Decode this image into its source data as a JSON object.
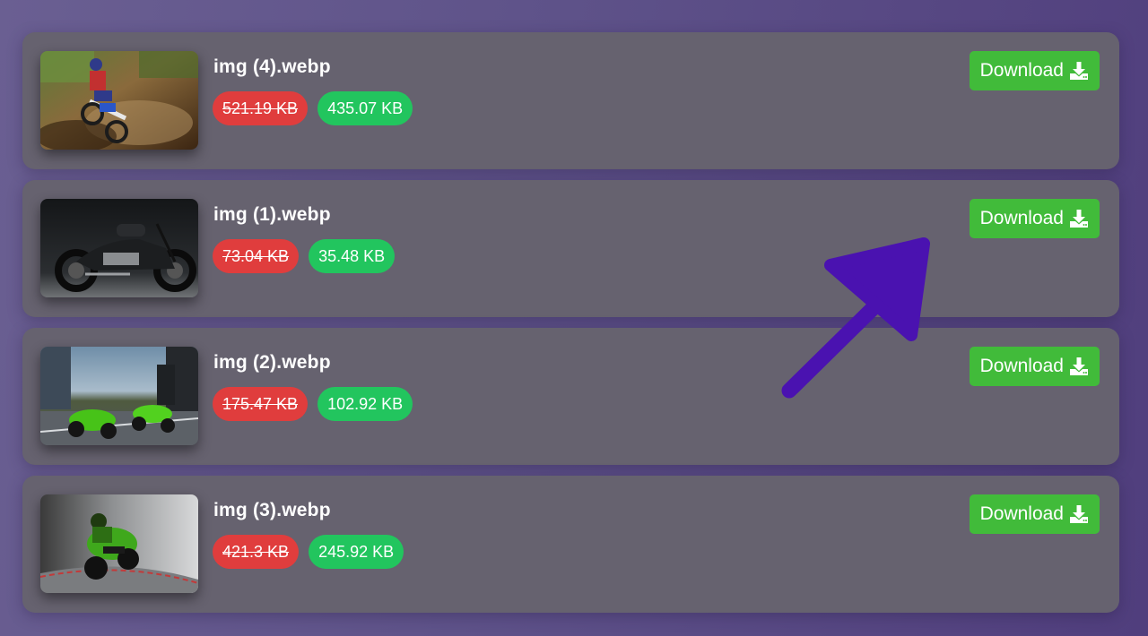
{
  "files": [
    {
      "name": "img (4).webp",
      "original_size": "521.19 KB",
      "compressed_size": "435.07 KB",
      "thumbnail": "dirt-bike-rider-thumbnail",
      "download_label": "Download"
    },
    {
      "name": "img (1).webp",
      "original_size": "73.04 KB",
      "compressed_size": "35.48 KB",
      "thumbnail": "cruiser-motorcycle-thumbnail",
      "download_label": "Download"
    },
    {
      "name": "img (2).webp",
      "original_size": "175.47 KB",
      "compressed_size": "102.92 KB",
      "thumbnail": "green-racing-bikes-thumbnail",
      "download_label": "Download"
    },
    {
      "name": "img (3).webp",
      "original_size": "421.3 KB",
      "compressed_size": "245.92 KB",
      "thumbnail": "green-sportbike-thumbnail",
      "download_label": "Download"
    }
  ],
  "icons": {
    "download": "download-icon",
    "annotation": "pointing-arrow-icon"
  },
  "colors": {
    "card": "#66626f",
    "original_badge": "#e03d3d",
    "compressed_badge": "#22c55e",
    "download_button": "#41bb3a",
    "annotation_arrow": "#4a12b0"
  }
}
